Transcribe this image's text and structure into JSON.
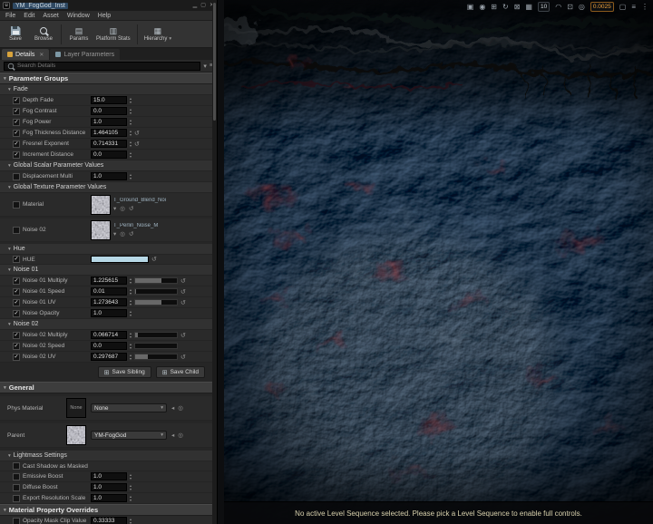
{
  "window": {
    "title": "YM_FogGod_Inst",
    "menu": [
      "File",
      "Edit",
      "Asset",
      "Window",
      "Help"
    ]
  },
  "toolbar": {
    "save_label": "Save",
    "browse_label": "Browse",
    "params_label": "Params",
    "platform_stats_label": "Platform Stats",
    "hierarchy_label": "Hierarchy"
  },
  "tabs": [
    {
      "label": "Details",
      "active": true
    },
    {
      "label": "Layer Parameters",
      "active": false
    }
  ],
  "details": {
    "search_placeholder": "Search Details",
    "sections": [
      {
        "kind": "top",
        "label": "Parameter Groups"
      },
      {
        "kind": "group",
        "label": "Fade",
        "rows": [
          {
            "check": true,
            "label": "Depth Fade",
            "value": "15.0",
            "ctrl": "spin"
          },
          {
            "check": true,
            "label": "Fog Contrast",
            "value": "0.0",
            "ctrl": "spin"
          },
          {
            "check": true,
            "label": "Fog Power",
            "value": "1.0",
            "ctrl": "spin"
          },
          {
            "check": true,
            "label": "Fog Thickness Distance",
            "value": "1.464105",
            "ctrl": "spin",
            "reset": true
          },
          {
            "check": true,
            "label": "Fresnel Exponent",
            "value": "0.714331",
            "ctrl": "spin",
            "reset": true
          },
          {
            "check": true,
            "label": "Increment Distance",
            "value": "0.0",
            "ctrl": "spin"
          }
        ]
      },
      {
        "kind": "group",
        "label": "Global Scalar Parameter Values",
        "rows": [
          {
            "check": false,
            "label": "Displacement Multi",
            "value": "1.0",
            "ctrl": "spin"
          }
        ]
      },
      {
        "kind": "group",
        "label": "Global Texture Parameter Values",
        "rows": [
          {
            "check": false,
            "label": "Material",
            "value": "T_Ground_Blend_Noi",
            "ctrl": "texture"
          },
          {
            "check": false,
            "label": "Noise 02",
            "value": "T_Perlin_Noise_M",
            "ctrl": "texture"
          }
        ]
      },
      {
        "kind": "group",
        "label": "Hue",
        "rows": [
          {
            "check": true,
            "label": "HUE",
            "value": "#b7d8e6",
            "ctrl": "color"
          }
        ]
      },
      {
        "kind": "group",
        "label": "Noise 01",
        "rows": [
          {
            "check": true,
            "label": "Noise 01 Multiply",
            "value": "1.225615",
            "ctrl": "slider",
            "frac": 0.62,
            "reset": true
          },
          {
            "check": true,
            "label": "Noise 01 Speed",
            "value": "0.01",
            "ctrl": "slider",
            "frac": 0.02,
            "reset": true
          },
          {
            "check": true,
            "label": "Noise 01 UV",
            "value": "1.273643",
            "ctrl": "slider",
            "frac": 0.64,
            "reset": true
          },
          {
            "check": true,
            "label": "Noise Opacity",
            "value": "1.0",
            "ctrl": "spin"
          }
        ]
      },
      {
        "kind": "group",
        "label": "Noise 02",
        "rows": [
          {
            "check": true,
            "label": "Noise 02 Multiply",
            "value": "0.066714",
            "ctrl": "slider",
            "frac": 0.07,
            "reset": true
          },
          {
            "check": true,
            "label": "Noise 02 Speed",
            "value": "0.0",
            "ctrl": "slider",
            "frac": 0
          },
          {
            "check": true,
            "label": "Noise 02 UV",
            "value": "0.297687",
            "ctrl": "slider",
            "frac": 0.3,
            "reset": true
          }
        ]
      },
      {
        "kind": "buttons",
        "buttons": [
          {
            "label": "Save Sibling"
          },
          {
            "label": "Save Child"
          }
        ]
      },
      {
        "kind": "top",
        "label": "General"
      },
      {
        "kind": "asset",
        "label": "Phys Material",
        "value": "None",
        "thumb": "none"
      },
      {
        "kind": "asset",
        "label": "Parent",
        "value": "YM-FogGod",
        "thumb": "noise"
      },
      {
        "kind": "group",
        "label": "Lightmass Settings",
        "rows": [
          {
            "check": false,
            "label": "Cast Shadow as Masked",
            "ctrl": "none"
          },
          {
            "check": false,
            "label": "Emissive Boost",
            "value": "1.0",
            "ctrl": "spin"
          },
          {
            "check": false,
            "label": "Diffuse Boost",
            "value": "1.0",
            "ctrl": "spin"
          },
          {
            "check": false,
            "label": "Export Resolution Scale",
            "value": "1.0",
            "ctrl": "spin"
          }
        ]
      },
      {
        "kind": "top",
        "label": "Material Property Overrides",
        "rows": [
          {
            "check": false,
            "label": "Opacity Mask Clip Value",
            "value": "0.33333",
            "ctrl": "spin"
          }
        ]
      }
    ]
  },
  "viewport": {
    "toolbar": {
      "icons": [
        "viewmode-icon",
        "show-icon",
        "move-icon",
        "rotate-icon",
        "scale-icon",
        "grid-snap-icon"
      ],
      "grid_value": "10",
      "icons2": [
        "rotation-snap-icon",
        "scale-snap-icon",
        "camera-icon"
      ],
      "camera_speed": "0.0025",
      "icons3": [
        "maximize-icon",
        "settings-icon",
        "menu-icon"
      ]
    },
    "status": "No active Level Sequence selected. Please pick a Level Sequence to enable full controls."
  }
}
